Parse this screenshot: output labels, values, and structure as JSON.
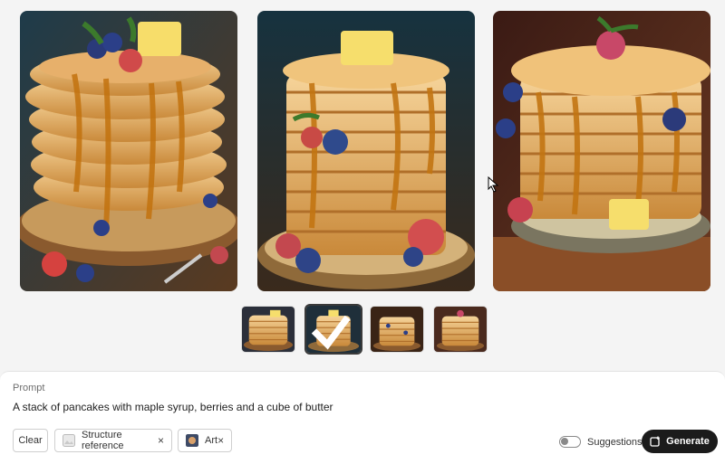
{
  "gallery": {
    "images": [
      {
        "alt": "pancake-stack-1"
      },
      {
        "alt": "pancake-stack-2"
      },
      {
        "alt": "pancake-stack-3"
      }
    ]
  },
  "thumbnails": {
    "count": 4,
    "selected_index": 1
  },
  "prompt": {
    "label": "Prompt",
    "text": "A stack of pancakes with maple syrup, berries and a cube of butter"
  },
  "controls": {
    "clear_label": "Clear",
    "structure_chip_label": "Structure reference",
    "art_chip_label": "Art",
    "remove_glyph": "×",
    "suggestions_label": "Suggestions",
    "suggestions_enabled": false,
    "generate_label": "Generate"
  },
  "colors": {
    "generate_bg": "#1b1b1b",
    "panel_bg": "#ffffff",
    "page_bg": "#f4f4f4"
  }
}
